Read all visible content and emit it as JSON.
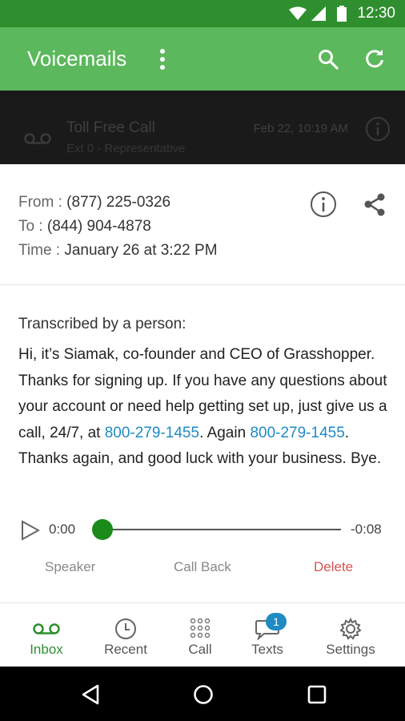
{
  "status_bar": {
    "time": "12:30"
  },
  "app_bar": {
    "title": "Voicemails"
  },
  "list_item": {
    "title": "Toll Free Call",
    "subtitle": "Ext 0 - Representative",
    "date": "Feb 22, 10:19 AM"
  },
  "detail": {
    "from_label": "From :",
    "from_value": "(877) 225-0326",
    "to_label": "To :",
    "to_value": "(844) 904-4878",
    "time_label": "Time :",
    "time_value": "January 26 at 3:22 PM",
    "transcript_heading": "Transcribed by a person:",
    "transcript_part1": "Hi, it’s Siamak, co-founder and CEO of Grasshopper. Thanks for signing up. If you have any questions about your account or need help getting set up, just give us a call, 24/7, at ",
    "transcript_link1": "800-279-1455",
    "transcript_part2": ". Again ",
    "transcript_link2": "800-279-1455",
    "transcript_part3": ". Thanks again, and good luck with your business. Bye."
  },
  "player": {
    "elapsed": "0:00",
    "remaining": "-0:08",
    "progress": 0.0
  },
  "actions": {
    "speaker": "Speaker",
    "call_back": "Call Back",
    "delete": "Delete"
  },
  "bottom_nav": {
    "inbox": "Inbox",
    "recent": "Recent",
    "call": "Call",
    "texts": "Texts",
    "texts_badge": "1",
    "settings": "Settings"
  },
  "colors": {
    "status_bar": "#2f8f2f",
    "app_bar": "#5cb85c",
    "accent": "#1a8a1a",
    "link": "#1e8bc3",
    "delete": "#d9534f"
  }
}
